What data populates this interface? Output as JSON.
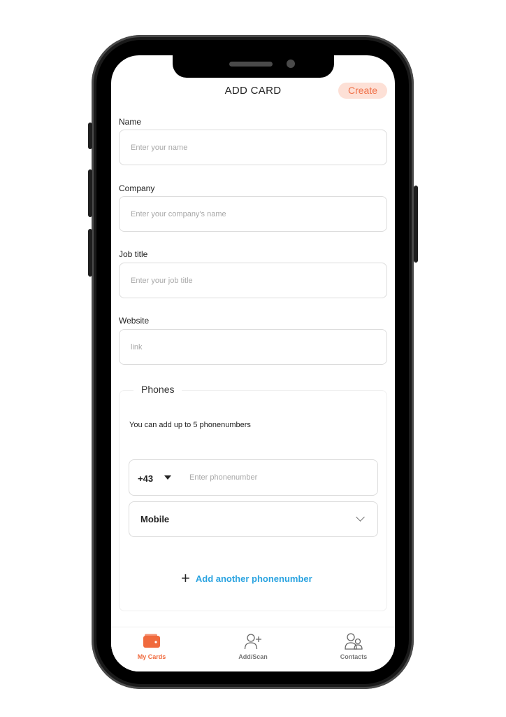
{
  "header": {
    "title": "ADD CARD",
    "create_label": "Create"
  },
  "form": {
    "name": {
      "label": "Name",
      "placeholder": "Enter your name"
    },
    "company": {
      "label": "Company",
      "placeholder": "Enter your company's name"
    },
    "job_title": {
      "label": "Job title",
      "placeholder": "Enter your job title"
    },
    "website": {
      "label": "Website",
      "placeholder": "link"
    }
  },
  "phones": {
    "title": "Phones",
    "hint": "You can add up to 5 phonenumbers",
    "country_code": "+43",
    "phone_placeholder": "Enter phonenumber",
    "type_selected": "Mobile",
    "add_label": "Add another phonenumber",
    "plus_glyph": "+"
  },
  "nav": {
    "items": [
      {
        "label": "My Cards",
        "icon": "wallet-icon",
        "active": true
      },
      {
        "label": "Add/Scan",
        "icon": "add-user-icon",
        "active": false
      },
      {
        "label": "Contacts",
        "icon": "contacts-icon",
        "active": false
      }
    ]
  },
  "colors": {
    "accent": "#f06a3d",
    "create_bg": "#fde0d6",
    "link_blue": "#2aa3e0"
  }
}
